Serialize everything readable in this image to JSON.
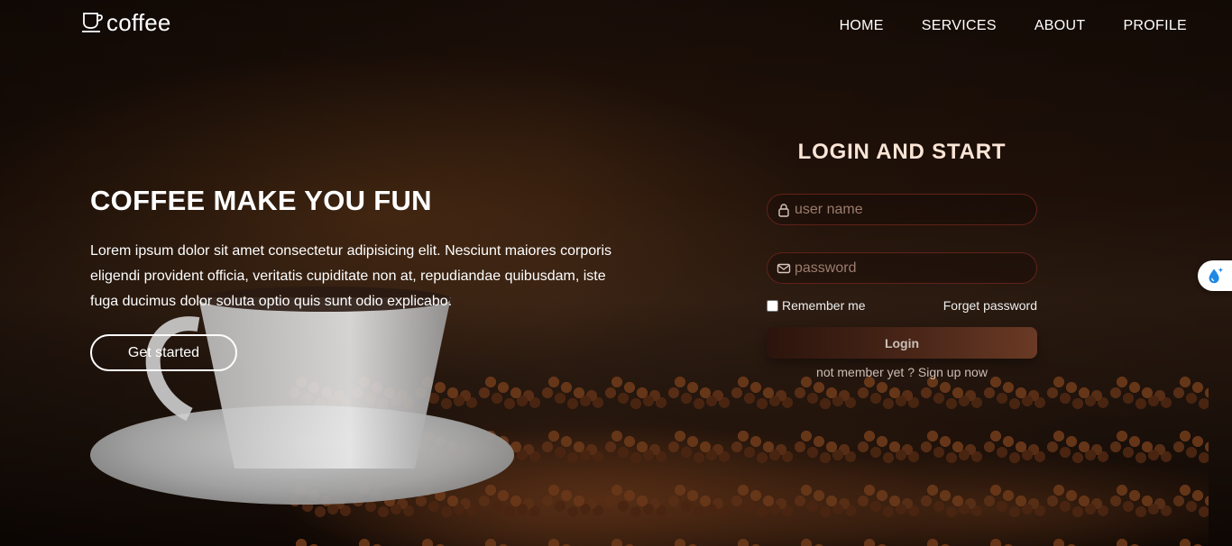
{
  "brand": {
    "name": "coffee",
    "icon": "coffee-cup-icon"
  },
  "nav": {
    "items": [
      {
        "label": "HOME"
      },
      {
        "label": "SERVICES"
      },
      {
        "label": "ABOUT"
      },
      {
        "label": "PROFILE"
      }
    ]
  },
  "hero": {
    "title": "COFFEE MAKE YOU FUN",
    "text": "Lorem ipsum dolor sit amet consectetur adipisicing elit. Nesciunt maiores corporis eligendi provident officia, veritatis cupiditate non at, repudiandae quibusdam, iste fuga ducimus dolor soluta optio quis sunt odio explicabo.",
    "cta_label": "Get started"
  },
  "login": {
    "title": "LOGIN AND START",
    "username_placeholder": "user name",
    "password_placeholder": "password",
    "remember_label": "Remember me",
    "forget_label": "Forget password",
    "button_label": "Login",
    "signup_prefix": "not member yet ? ",
    "signup_link": "Sign up now"
  },
  "widget": {
    "icon": "water-drop-sparkle-icon"
  },
  "colors": {
    "login_title": "#fbe5d6",
    "field_border": "#782820",
    "login_button_start": "#2b140c",
    "login_button_end": "#6a3a25",
    "widget_icon": "#1e88e5"
  }
}
